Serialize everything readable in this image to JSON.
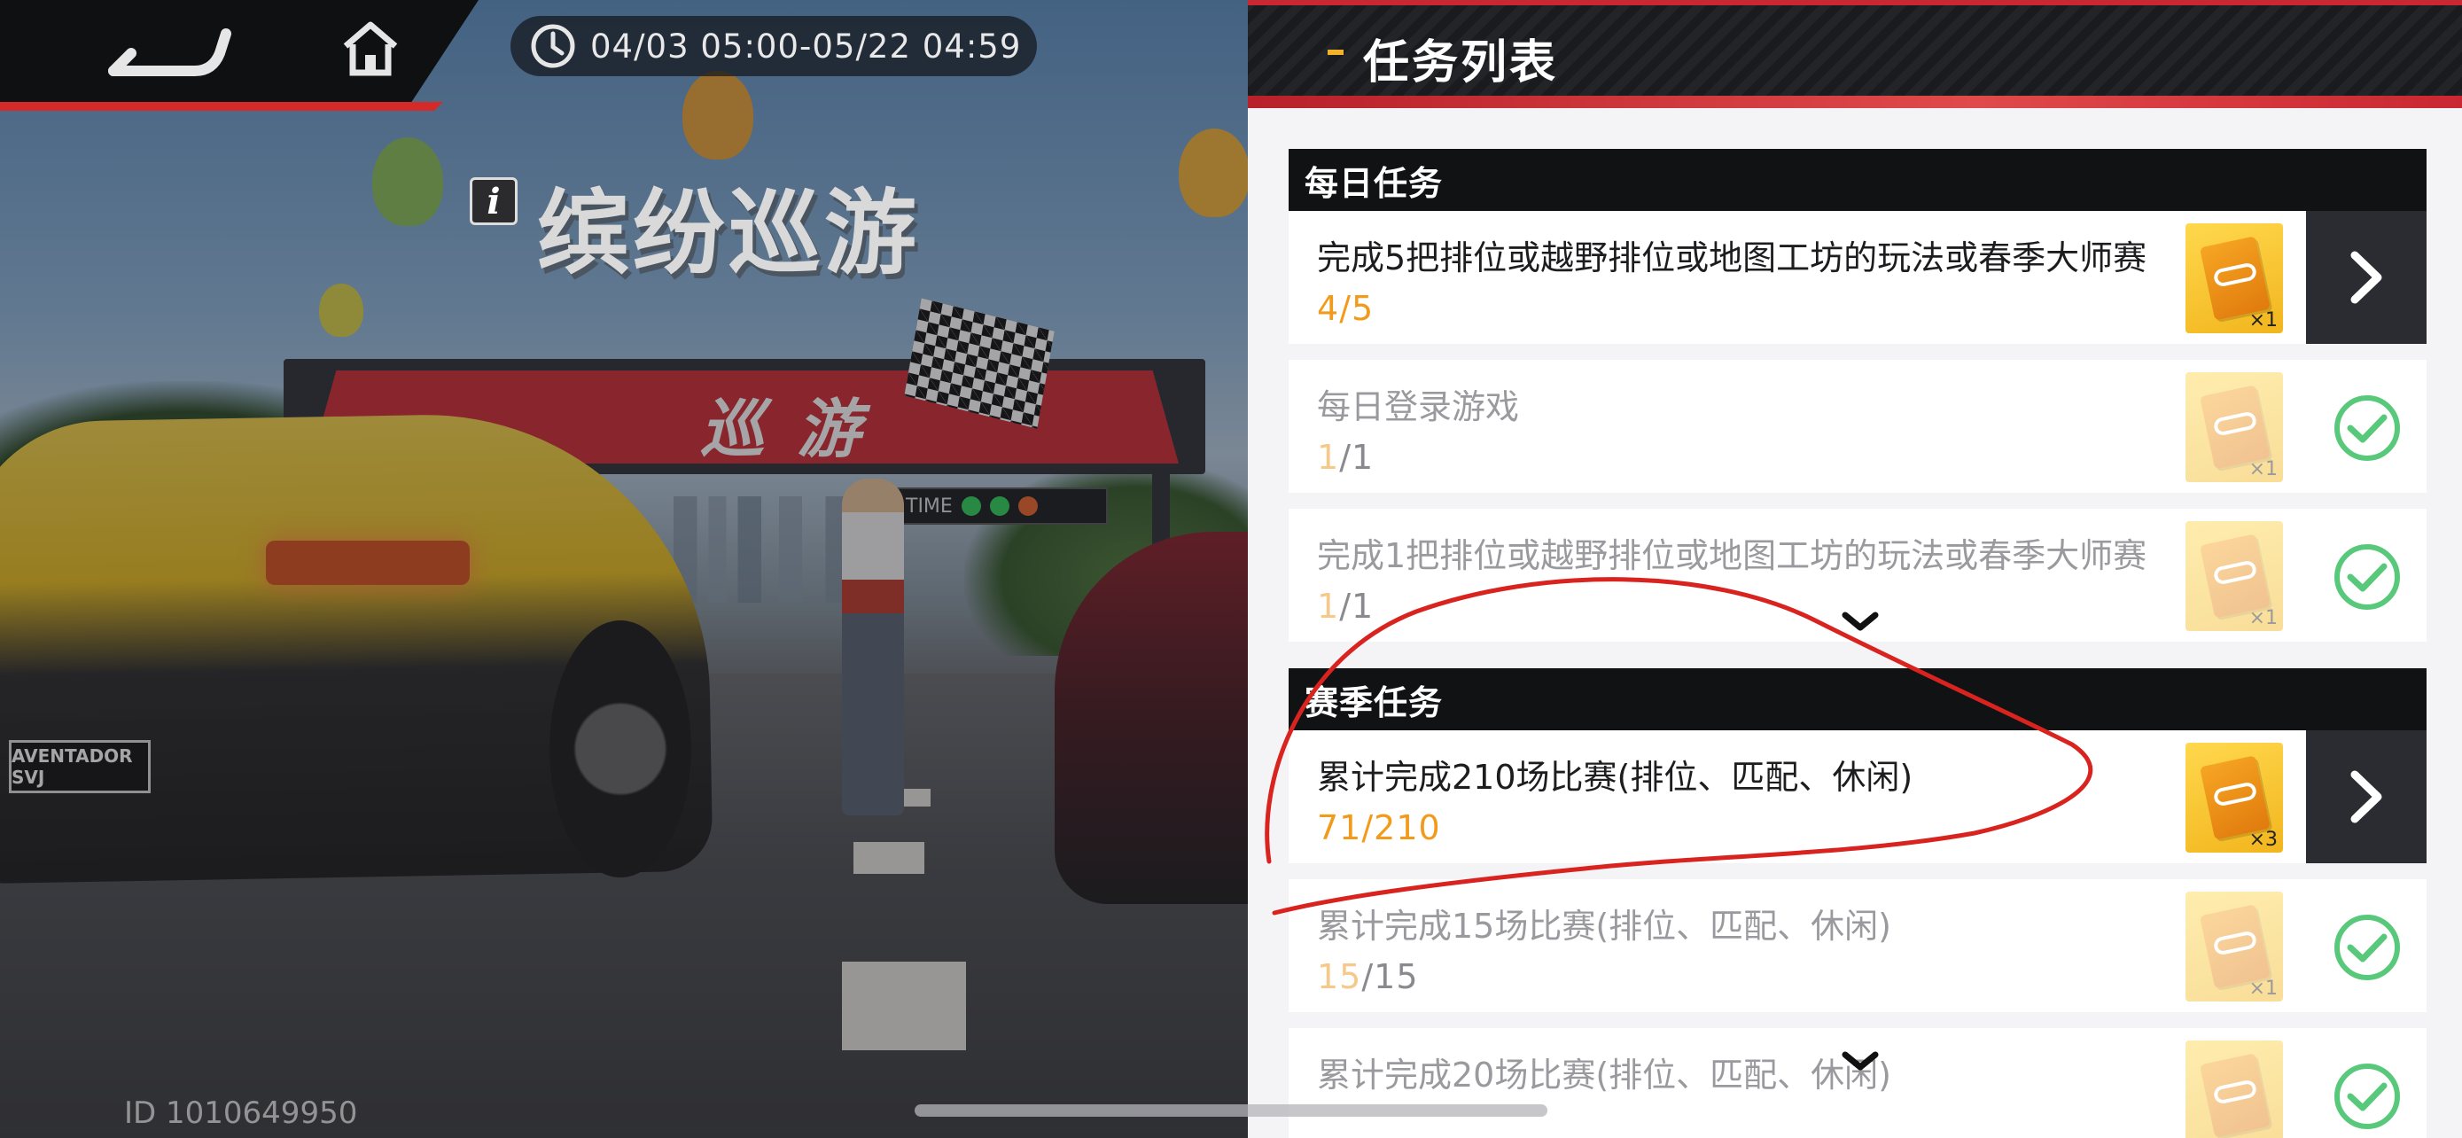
{
  "hud": {
    "timer_text": "04/03 05:00-05/22 04:59",
    "event_title": "缤纷巡游",
    "info_glyph": "i",
    "player_id": "ID 1010649950"
  },
  "scene": {
    "arch_text": "巡 游",
    "timeboard_text": "TIME",
    "car_plate": "AVENTADOR SVJ"
  },
  "panel": {
    "title": "任务列表",
    "sections": [
      {
        "name": "每日任务",
        "tasks": [
          {
            "name": "完成5把排位或越野排位或地图工坊的玩法或春季大师赛",
            "cur": "4",
            "sep": "/",
            "total": "5",
            "reward_qty": "×1",
            "state": "go"
          },
          {
            "name": "每日登录游戏",
            "cur": "1",
            "sep": "/",
            "total": "1",
            "reward_qty": "×1",
            "state": "done"
          },
          {
            "name": "完成1把排位或越野排位或地图工坊的玩法或春季大师赛",
            "cur": "1",
            "sep": "/",
            "total": "1",
            "reward_qty": "×1",
            "state": "done"
          }
        ]
      },
      {
        "name": "赛季任务",
        "tasks": [
          {
            "name": "累计完成210场比赛(排位、匹配、休闲)",
            "cur": "71",
            "sep": "/",
            "total": "210",
            "reward_qty": "×3",
            "state": "go"
          },
          {
            "name": "累计完成15场比赛(排位、匹配、休闲)",
            "cur": "15",
            "sep": "/",
            "total": "15",
            "reward_qty": "×1",
            "state": "done"
          },
          {
            "name": "累计完成20场比赛(排位、匹配、休闲)",
            "cur": "",
            "sep": "",
            "total": "",
            "reward_qty": "",
            "state": "done"
          }
        ]
      }
    ]
  },
  "colors": {
    "accent_red": "#c92731",
    "progress_orange": "#f29a1b",
    "check_green": "#58c97a",
    "reward_gold": "#f2b51d",
    "annotation_red": "#d8231f"
  },
  "icons": [
    "back-arrow-icon",
    "home-icon",
    "clock-icon",
    "info-icon",
    "chevron-right-icon",
    "check-circle-icon",
    "chevron-down-icon",
    "reward-card-icon"
  ]
}
